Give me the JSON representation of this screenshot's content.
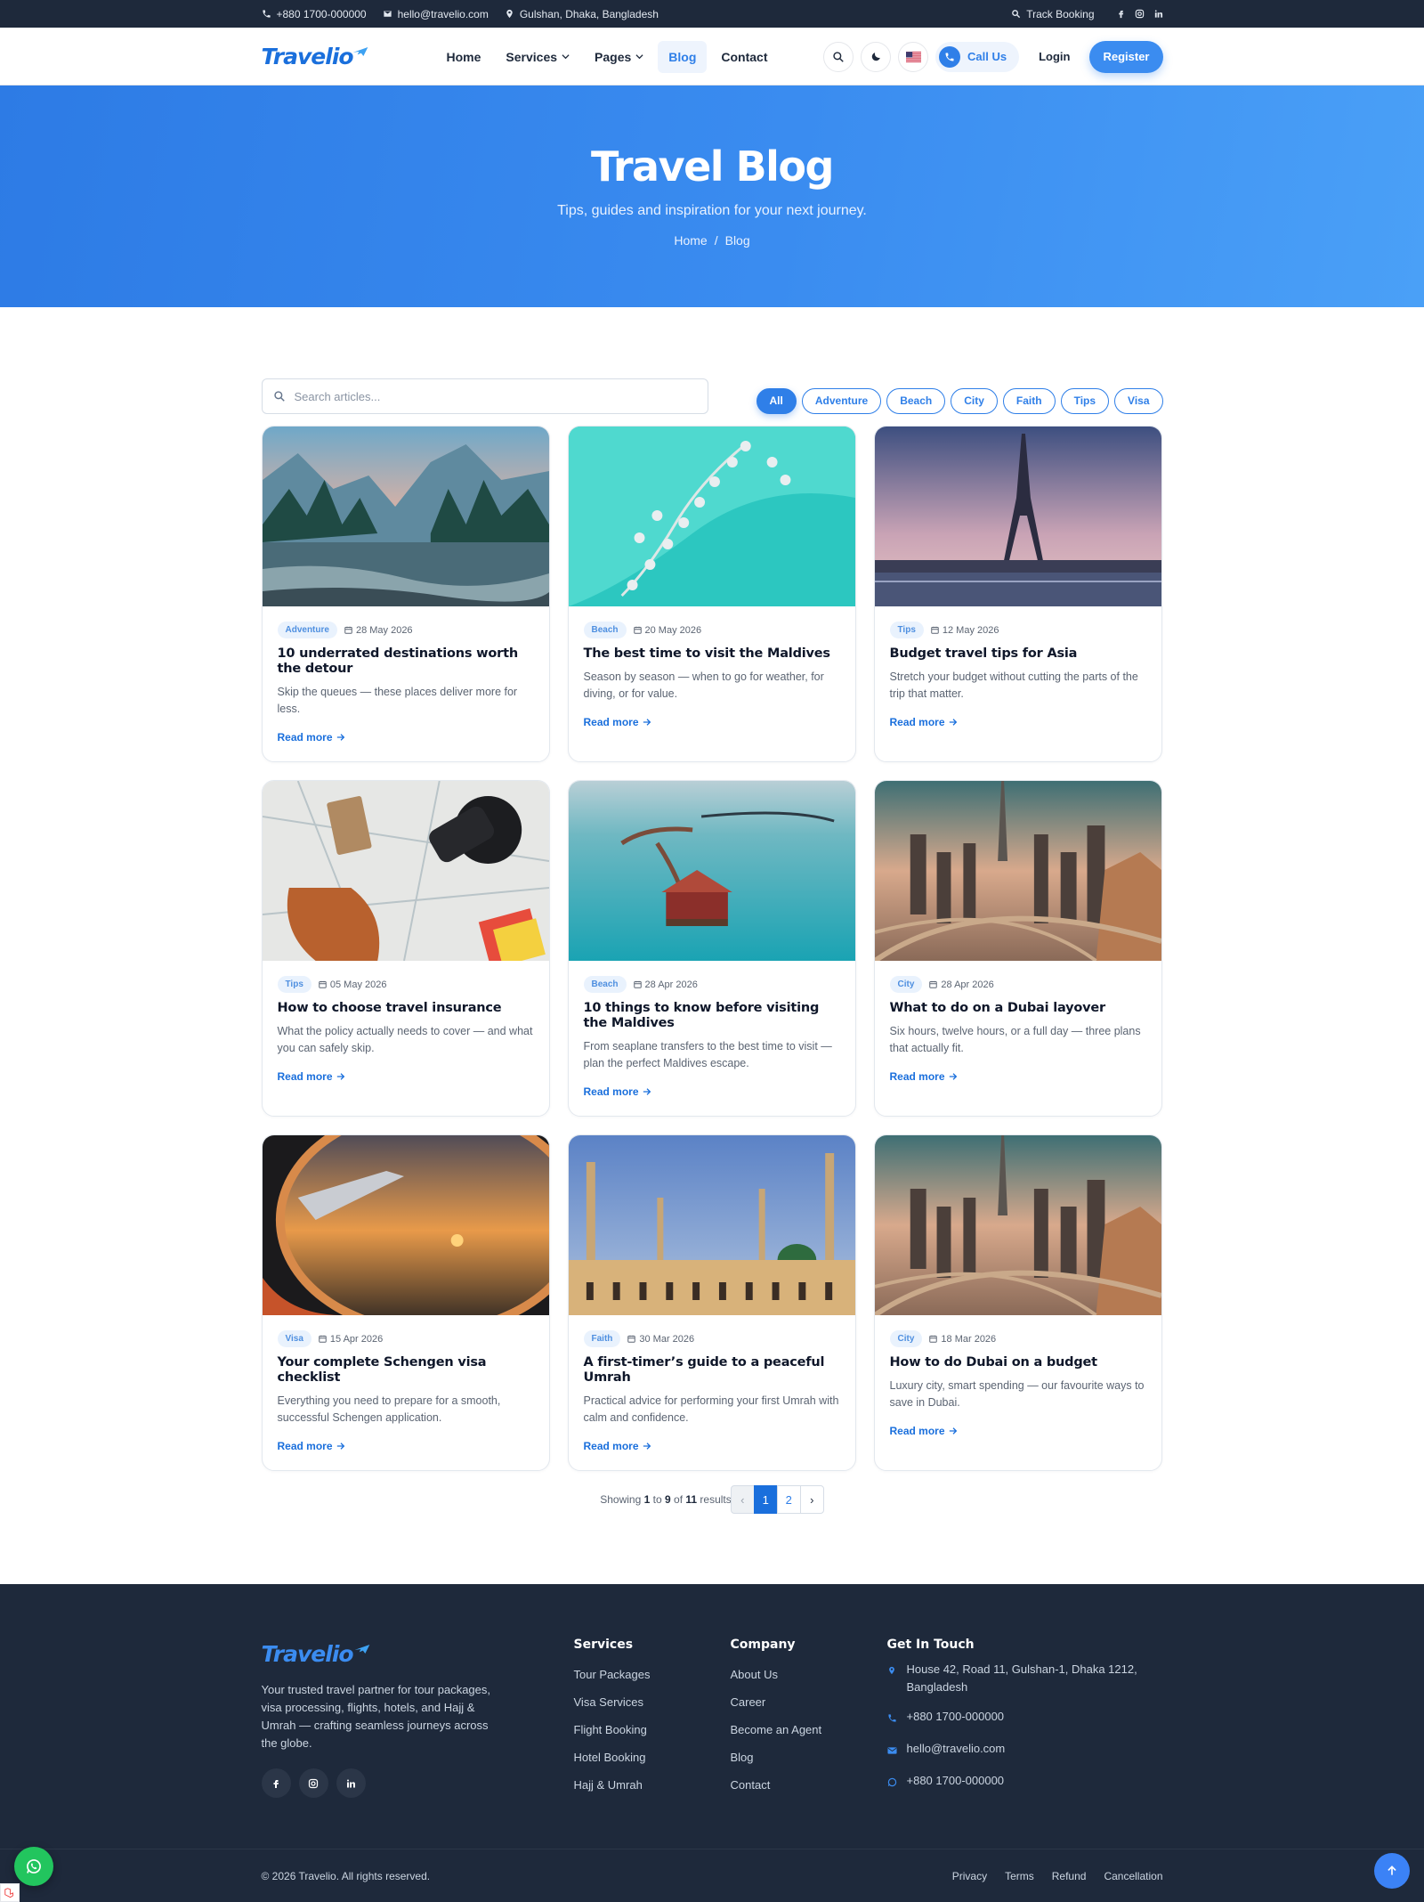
{
  "topbar": {
    "phone": "+880 1700-000000",
    "email": "hello@travelio.com",
    "location": "Gulshan, Dhaka, Bangladesh",
    "track": "Track Booking"
  },
  "brand": {
    "name": "Travelio",
    "color": "#1a6fdc"
  },
  "nav": {
    "home": "Home",
    "services": "Services",
    "pages": "Pages",
    "blog": "Blog",
    "contact": "Contact",
    "call_us": "Call Us",
    "login": "Login",
    "register": "Register"
  },
  "hero": {
    "title": "Travel Blog",
    "subtitle": "Tips, guides and inspiration for your next journey.",
    "crumb_home": "Home",
    "crumb_sep": "/",
    "crumb_current": "Blog"
  },
  "search": {
    "placeholder": "Search articles..."
  },
  "filters": [
    "All",
    "Adventure",
    "Beach",
    "City",
    "Faith",
    "Tips",
    "Visa"
  ],
  "posts": [
    {
      "tag": "Adventure",
      "date": "28 May 2026",
      "title": "10 underrated destinations worth the detour",
      "excerpt": "Skip the queues — these places deliver more for less.",
      "read": "Read more"
    },
    {
      "tag": "Beach",
      "date": "20 May 2026",
      "title": "The best time to visit the Maldives",
      "excerpt": "Season by season — when to go for weather, for diving, or for value.",
      "read": "Read more"
    },
    {
      "tag": "Tips",
      "date": "12 May 2026",
      "title": "Budget travel tips for Asia",
      "excerpt": "Stretch your budget without cutting the parts of the trip that matter.",
      "read": "Read more"
    },
    {
      "tag": "Tips",
      "date": "05 May 2026",
      "title": "How to choose travel insurance",
      "excerpt": "What the policy actually needs to cover — and what you can safely skip.",
      "read": "Read more"
    },
    {
      "tag": "Beach",
      "date": "28 Apr 2026",
      "title": "10 things to know before visiting the Maldives",
      "excerpt": "From seaplane transfers to the best time to visit — plan the perfect Maldives escape.",
      "read": "Read more"
    },
    {
      "tag": "City",
      "date": "28 Apr 2026",
      "title": "What to do on a Dubai layover",
      "excerpt": "Six hours, twelve hours, or a full day — three plans that actually fit.",
      "read": "Read more"
    },
    {
      "tag": "Visa",
      "date": "15 Apr 2026",
      "title": "Your complete Schengen visa checklist",
      "excerpt": "Everything you need to prepare for a smooth, successful Schengen application.",
      "read": "Read more"
    },
    {
      "tag": "Faith",
      "date": "30 Mar 2026",
      "title": "A first-timer’s guide to a peaceful Umrah",
      "excerpt": "Practical advice for performing your first Umrah with calm and confidence.",
      "read": "Read more"
    },
    {
      "tag": "City",
      "date": "18 Mar 2026",
      "title": "How to do Dubai on a budget",
      "excerpt": "Luxury city, smart spending — our favourite ways to save in Dubai.",
      "read": "Read more"
    }
  ],
  "pagination": {
    "showing": "Showing",
    "from": "1",
    "to_word": "to",
    "to": "9",
    "of_word": "of",
    "total": "11",
    "results": "results",
    "prev": "‹",
    "page1": "1",
    "page2": "2",
    "next": "›"
  },
  "footer": {
    "description": "Your trusted travel partner for tour packages, visa processing, flights, hotels, and Hajj & Umrah — crafting seamless journeys across the globe.",
    "services_title": "Services",
    "services": [
      "Tour Packages",
      "Visa Services",
      "Flight Booking",
      "Hotel Booking",
      "Hajj & Umrah"
    ],
    "company_title": "Company",
    "company": [
      "About Us",
      "Career",
      "Become an Agent",
      "Blog",
      "Contact"
    ],
    "contact_title": "Get In Touch",
    "address": "House 42, Road 11, Gulshan-1, Dhaka 1212, Bangladesh",
    "phone": "+880 1700-000000",
    "email": "hello@travelio.com",
    "whatsapp": "+880 1700-000000",
    "copyright": "© 2026 Travelio. All rights reserved.",
    "legal": [
      "Privacy",
      "Terms",
      "Refund",
      "Cancellation"
    ]
  }
}
